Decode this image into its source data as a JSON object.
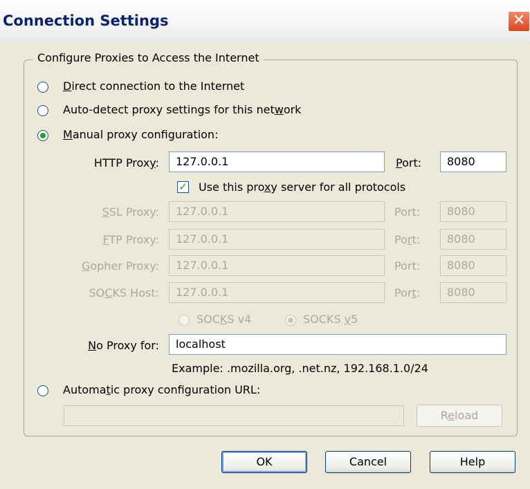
{
  "window": {
    "title": "Connection Settings",
    "close_glyph": "✕"
  },
  "group": {
    "legend": "Configure Proxies to Access the Internet"
  },
  "options": {
    "direct": {
      "pre": "",
      "key": "D",
      "post": "irect connection to the Internet",
      "selected": false
    },
    "auto_detect": {
      "pre": "Auto-detect proxy settings for this net",
      "key": "w",
      "post": "ork",
      "selected": false
    },
    "manual": {
      "pre": "",
      "key": "M",
      "post": "anual proxy configuration:",
      "selected": true
    },
    "auto_url": {
      "pre": "Automa",
      "key": "t",
      "post": "ic proxy configuration URL:",
      "selected": false
    }
  },
  "http": {
    "label_pre": "HTTP Prox",
    "label_key": "y",
    "label_post": ":",
    "value": "127.0.0.1",
    "port_key": "P",
    "port_post": "ort:",
    "port": "8080"
  },
  "use_same": {
    "pre": "Use this pro",
    "key": "x",
    "post": "y server for all protocols",
    "checked": true
  },
  "ssl": {
    "label_pre": "",
    "label_key": "S",
    "label_post": "SL Proxy:",
    "value": "127.0.0.1",
    "port_pre": "Port:",
    "port_key": "",
    "port_post": "",
    "port": "8080"
  },
  "ftp": {
    "label_pre": "",
    "label_key": "F",
    "label_post": "TP Proxy:",
    "value": "127.0.0.1",
    "port_pre": "Po",
    "port_key": "r",
    "port_post": "t:",
    "port": "8080"
  },
  "gopher": {
    "label_pre": "",
    "label_key": "G",
    "label_post": "opher Proxy:",
    "value": "127.0.0.1",
    "port_pre": "Port:",
    "port_key": "",
    "port_post": "",
    "port": "8080"
  },
  "socks": {
    "label_pre": "SO",
    "label_key": "C",
    "label_post": "KS Host:",
    "value": "127.0.0.1",
    "port_pre": "Por",
    "port_key": "t",
    "port_post": ":",
    "port": "8080",
    "v4_pre": "SOC",
    "v4_key": "K",
    "v4_post": "S v4",
    "v5_pre": "SOCKS ",
    "v5_key": "v",
    "v5_post": "5",
    "selected_version": "v5"
  },
  "no_proxy": {
    "label_key": "N",
    "label_post": "o Proxy for:",
    "value": "localhost",
    "example": "Example: .mozilla.org, .net.nz, 192.168.1.0/24"
  },
  "auto_config": {
    "url_value": "",
    "reload_pre": "R",
    "reload_key": "e",
    "reload_post": "load"
  },
  "buttons": {
    "ok": "OK",
    "cancel": "Cancel",
    "help": "Help"
  },
  "colors": {
    "dialog_bg": "#ece9d8",
    "title_text": "#0a246a",
    "close_button": "#d8461f",
    "radio_dot": "#21a121",
    "disabled_text": "#aca899"
  }
}
